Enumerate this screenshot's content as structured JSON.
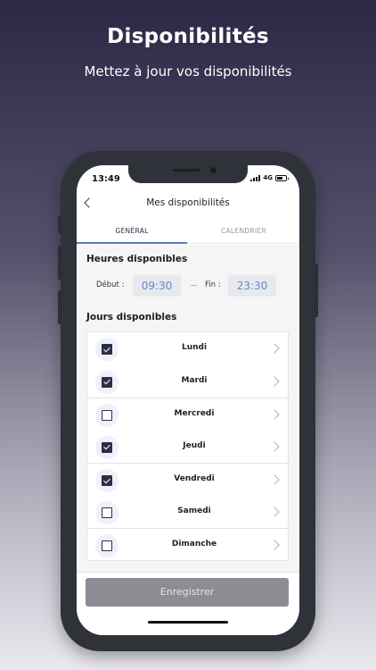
{
  "hero": {
    "title": "Disponibilités",
    "subtitle": "Mettez à jour vos disponibilités"
  },
  "status_bar": {
    "time": "13:49",
    "network": "4G"
  },
  "nav": {
    "title": "Mes disponibilités",
    "back_icon": "chevron-left-icon"
  },
  "tabs": [
    {
      "label": "GÉNÉRAL",
      "active": true
    },
    {
      "label": "CALENDRIER",
      "active": false
    }
  ],
  "hours": {
    "title": "Heures disponibles",
    "start_label": "Début :",
    "start_value": "09:30",
    "end_label": "Fin :",
    "end_value": "23:30"
  },
  "days": {
    "title": "Jours disponibles",
    "items": [
      {
        "label": "Lundi",
        "checked": true
      },
      {
        "label": "Mardi",
        "checked": true
      },
      {
        "label": "Mercredi",
        "checked": false
      },
      {
        "label": "Jeudi",
        "checked": true
      },
      {
        "label": "Vendredi",
        "checked": true
      },
      {
        "label": "Samedi",
        "checked": false
      },
      {
        "label": "Dimanche",
        "checked": false
      }
    ]
  },
  "footer": {
    "save_label": "Enregistrer"
  },
  "colors": {
    "accent": "#4d7fc7",
    "primary_dark": "#2e2d47",
    "button_disabled": "#8d8c94"
  }
}
